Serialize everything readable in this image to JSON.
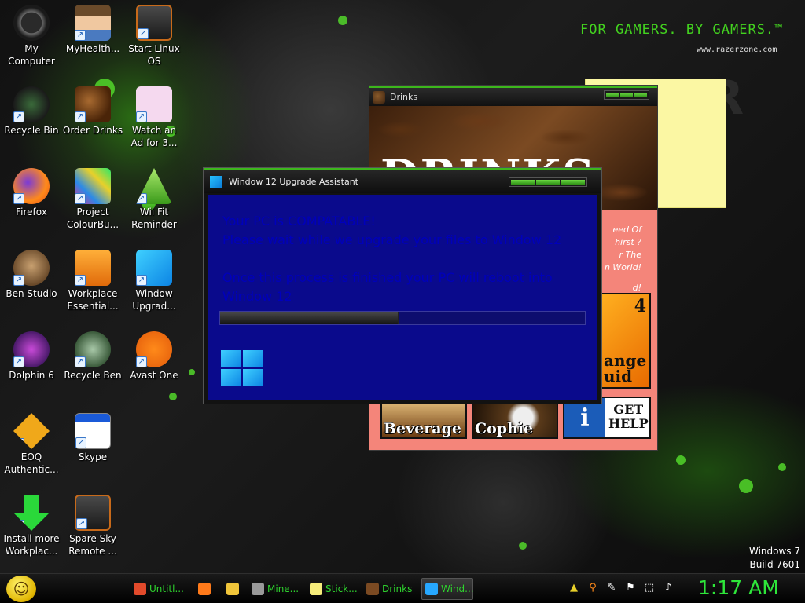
{
  "desktop_icons": [
    {
      "label": "My\nComputer",
      "icon": "computer-icon"
    },
    {
      "label": "MyHealth...",
      "icon": "person-icon"
    },
    {
      "label": "Start Linux\nOS",
      "icon": "monitor-icon"
    },
    {
      "label": "Recycle Bin",
      "icon": "recycle-bin-icon"
    },
    {
      "label": "Order Drinks",
      "icon": "coffee-beans-icon"
    },
    {
      "label": "Watch an\nAd for 3...",
      "icon": "letter-t-icon"
    },
    {
      "label": "Firefox",
      "icon": "firefox-icon"
    },
    {
      "label": "Project\nColourBu...",
      "icon": "collage-icon"
    },
    {
      "label": "Wii Fit\nReminder",
      "icon": "triangle-icon"
    },
    {
      "label": "Ben Studio",
      "icon": "dog-icon"
    },
    {
      "label": "Workplace\nEssential...",
      "icon": "folder-icon"
    },
    {
      "label": "Window\nUpgrad...",
      "icon": "windows-logo-icon"
    },
    {
      "label": "Dolphin 6",
      "icon": "dolphin-icon"
    },
    {
      "label": "Recycle Ben",
      "icon": "ben-face-icon"
    },
    {
      "label": "Avast One",
      "icon": "avast-icon"
    },
    {
      "label": "EOQ\nAuthentic...",
      "icon": "key-icon"
    },
    {
      "label": "Skype",
      "icon": "window-icon"
    },
    {
      "label": "Install more\nWorkplac...",
      "icon": "download-arrow-icon"
    },
    {
      "label": "Spare Sky\nRemote ...",
      "icon": "monitor-icon"
    }
  ],
  "branding": {
    "slogan": "FOR GAMERS. BY GAMERS.™",
    "url": "www.razerzone.com",
    "os_name": "Windows 7",
    "os_build": "Build 7601"
  },
  "drinks_window": {
    "title": "Drinks",
    "banner_text": "DRINKS",
    "side_text": [
      "eed Of",
      "hirst ?",
      "r The",
      "n World!",
      "d!"
    ],
    "tiles": [
      "Beverage",
      "Cophie",
      "GET\nHELP"
    ],
    "orange_tile_text": "ange\nuid",
    "orange_tile_number": "4"
  },
  "upgrade_window": {
    "title": "Window 12 Upgrade Assistant",
    "line1": "Your PC is COMPATABLE!",
    "line2": "Please wait while we upgrade your files to Window 12",
    "line3": "Once this process is finished your PC will reboot into",
    "line4": "Window 12",
    "progress_fraction": 0.49
  },
  "taskbar": {
    "items": [
      {
        "label": "Untitl...",
        "icon": "chrome-icon",
        "color": "#e24a2b"
      },
      {
        "label": "",
        "icon": "firefox-icon",
        "color": "#ff7a1a"
      },
      {
        "label": "",
        "icon": "folder-icon",
        "color": "#f0c53a"
      },
      {
        "label": "Mine...",
        "icon": "gear-icon",
        "color": "#999999"
      },
      {
        "label": "Stick...",
        "icon": "sticky-notes-icon",
        "color": "#f5ec7a"
      },
      {
        "label": "Drinks",
        "icon": "coffee-beans-icon",
        "color": "#7b4a22"
      },
      {
        "label": "Wind...",
        "icon": "windows-logo-icon",
        "color": "#27a8ff"
      }
    ],
    "tray_icons": [
      "triangle-icon",
      "search-icon",
      "pen-icon",
      "flag-icon",
      "network-icon",
      "volume-icon"
    ],
    "clock": "1:17 AM"
  }
}
